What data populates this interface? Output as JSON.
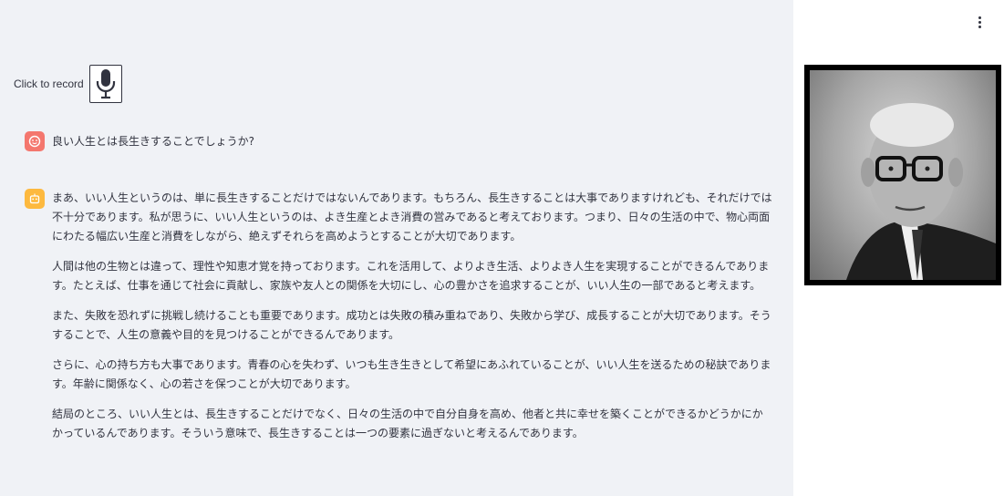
{
  "header": {
    "menu_icon": "kebab-menu-icon"
  },
  "recorder": {
    "label": "Click to record",
    "icon": "microphone-icon"
  },
  "chat": {
    "user_message": "良い人生とは長生きすることでしょうか?",
    "assistant_paragraphs": [
      "まあ、いい人生というのは、単に長生きすることだけではないんであります。もちろん、長生きすることは大事でありますけれども、それだけでは不十分であります。私が思うに、いい人生というのは、よき生産とよき消費の営みであると考えております。つまり、日々の生活の中で、物心両面にわたる幅広い生産と消費をしながら、絶えずそれらを高めようとすることが大切であります。",
      "人間は他の生物とは違って、理性や知恵才覚を持っております。これを活用して、よりよき生活、よりよき人生を実現することができるんであります。たとえば、仕事を通じて社会に貢献し、家族や友人との関係を大切にし、心の豊かさを追求することが、いい人生の一部であると考えます。",
      "また、失敗を恐れずに挑戦し続けることも重要であります。成功とは失敗の積み重ねであり、失敗から学び、成長することが大切であります。そうすることで、人生の意義や目的を見つけることができるんであります。",
      "さらに、心の持ち方も大事であります。青春の心を失わず、いつも生き生きとして希望にあふれていることが、いい人生を送るための秘訣であります。年齢に関係なく、心の若さを保つことが大切であります。",
      "結局のところ、いい人生とは、長生きすることだけでなく、日々の生活の中で自分自身を高め、他者と共に幸せを築くことができるかどうかにかかっているんであります。そういう意味で、長生きすることは一つの要素に過ぎないと考えるんであります。"
    ]
  },
  "colors": {
    "user_avatar": "#f4776e",
    "bot_avatar": "#fdb93f",
    "main_bg": "#f0f2f6"
  }
}
